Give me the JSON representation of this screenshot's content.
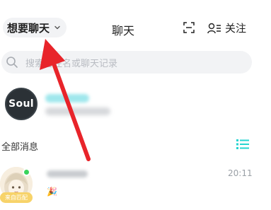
{
  "header": {
    "mood_label": "想要聊天",
    "title": "聊天",
    "follow_label": "关注",
    "icons": {
      "mood_chevron": "chevron-down-icon",
      "scan": "scan-icon",
      "follow": "person-list-icon"
    }
  },
  "search": {
    "placeholder": "搜索备注名或聊天记录"
  },
  "pinned": {
    "avatar_text": "Soul",
    "accent": "#25d4d0"
  },
  "section": {
    "title": "全部消息",
    "icon": "list-view-icon",
    "icon_color": "#25d4d0"
  },
  "chats": [
    {
      "time": "20:11",
      "badge": "来自匹配",
      "emoji": "🎉",
      "online_color": "#3ad35a"
    }
  ],
  "annotation": {
    "arrow_color": "#e8242a"
  }
}
